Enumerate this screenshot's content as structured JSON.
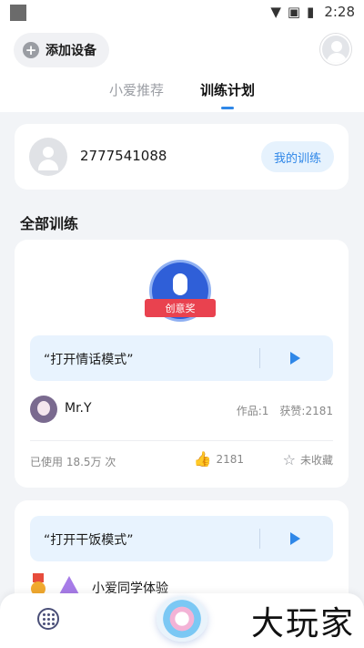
{
  "status_bar": {
    "time": "2:28",
    "icons": [
      "wifi-icon",
      "no-sim-icon",
      "battery-charging-icon"
    ]
  },
  "header": {
    "add_device_label": "添加设备",
    "tabs": [
      {
        "label": "小爱推荐",
        "active": false
      },
      {
        "label": "训练计划",
        "active": true
      }
    ]
  },
  "user": {
    "id": "2777541088",
    "my_training_label": "我的训练"
  },
  "section_title": "全部训练",
  "trainings": [
    {
      "badge_label": "创意奖",
      "command": "“打开情话模式”",
      "author": "Mr.Y",
      "works": "作品:1",
      "likes_received": "获赞:2181",
      "used": "已使用 18.5万 次",
      "like_count": "2181",
      "favorite_label": "未收藏"
    },
    {
      "command": "“打开干饭模式”",
      "author": "小爱同学体验"
    }
  ],
  "watermark": "大玩家",
  "colors": {
    "accent": "#2f87e8",
    "badge_blue": "#2f5fd8",
    "ribbon_red": "#e9424f"
  }
}
